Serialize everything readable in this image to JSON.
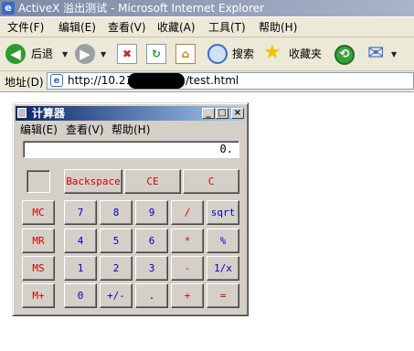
{
  "window": {
    "title": "ActiveX 溢出测试 - Microsoft Internet Explorer",
    "app_icon": "e"
  },
  "menubar": {
    "items": [
      {
        "label": "文件(F)"
      },
      {
        "label": "编辑(E)"
      },
      {
        "label": "查看(V)"
      },
      {
        "label": "收藏(A)"
      },
      {
        "label": "工具(T)"
      },
      {
        "label": "帮助(H)"
      }
    ]
  },
  "toolbar": {
    "back_label": "后退",
    "search_label": "搜索",
    "favorites_label": "收藏夹",
    "icons": {
      "back": "back-arrow-icon",
      "forward": "forward-arrow-icon",
      "stop": "stop-icon",
      "refresh": "refresh-icon",
      "home": "home-icon",
      "search": "search-magnifier-icon",
      "favorites": "favorites-star-icon",
      "history": "history-icon",
      "mail": "mail-icon"
    },
    "glyphs": {
      "back": "◀",
      "forward": "▶",
      "stop": "✖",
      "refresh": "↻",
      "home": "⌂",
      "search": "⚲",
      "favorites": "★",
      "history": "⟲",
      "mail": "✉",
      "dropdown": "▼"
    }
  },
  "address": {
    "label": "地址(D)",
    "url_start": "http://10.21",
    "url_end": "/test.html",
    "page_icon": "e"
  },
  "calculator": {
    "title": "计算器",
    "menu": [
      {
        "label": "编辑(E)"
      },
      {
        "label": "查看(V)"
      },
      {
        "label": "帮助(H)"
      }
    ],
    "window_buttons": {
      "minimize": "_",
      "maximize": "□",
      "close": "×"
    },
    "display_value": "0.",
    "top_buttons": [
      {
        "label": "Backspace",
        "color": "red"
      },
      {
        "label": "CE",
        "color": "red"
      },
      {
        "label": "C",
        "color": "red"
      }
    ],
    "memory_buttons": [
      {
        "label": "MC"
      },
      {
        "label": "MR"
      },
      {
        "label": "MS"
      },
      {
        "label": "M+"
      }
    ],
    "keypad_rows": [
      [
        {
          "label": "7",
          "color": "blue"
        },
        {
          "label": "8",
          "color": "blue"
        },
        {
          "label": "9",
          "color": "blue"
        },
        {
          "label": "/",
          "color": "red"
        },
        {
          "label": "sqrt",
          "color": "blue"
        }
      ],
      [
        {
          "label": "4",
          "color": "blue"
        },
        {
          "label": "5",
          "color": "blue"
        },
        {
          "label": "6",
          "color": "blue"
        },
        {
          "label": "*",
          "color": "red"
        },
        {
          "label": "%",
          "color": "blue"
        }
      ],
      [
        {
          "label": "1",
          "color": "blue"
        },
        {
          "label": "2",
          "color": "blue"
        },
        {
          "label": "3",
          "color": "blue"
        },
        {
          "label": "-",
          "color": "red"
        },
        {
          "label": "1/x",
          "color": "blue"
        }
      ],
      [
        {
          "label": "0",
          "color": "blue"
        },
        {
          "label": "+/-",
          "color": "blue"
        },
        {
          "label": ".",
          "color": "blue"
        },
        {
          "label": "+",
          "color": "red"
        },
        {
          "label": "=",
          "color": "red"
        }
      ]
    ]
  },
  "colors": {
    "calc_red": "#d40000",
    "calc_blue": "#0000cc",
    "face": "#d4d0c8",
    "ie_chrome": "#ece9d8"
  }
}
